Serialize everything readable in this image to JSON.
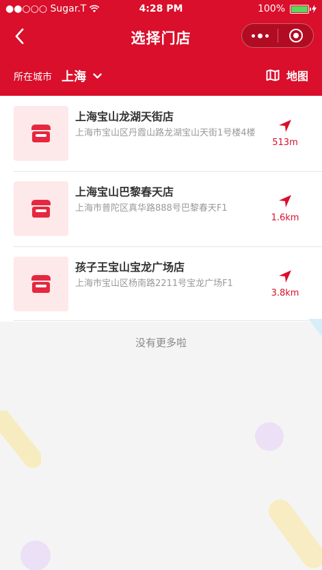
{
  "status_bar": {
    "carrier": "●●○○○ Sugar.T",
    "time": "4:28 PM",
    "battery": "100%"
  },
  "nav": {
    "title": "选择门店",
    "back_icon": "chevron-left-icon",
    "more_icon": "more-dots-icon",
    "close_icon": "target-circle-icon"
  },
  "city_bar": {
    "label": "所在城市",
    "city": "上海",
    "map_label": "地图"
  },
  "stores": [
    {
      "name": "上海宝山龙湖天街店",
      "address": "上海市宝山区丹霞山路龙湖宝山天街1号楼4楼",
      "distance": "513m"
    },
    {
      "name": "上海宝山巴黎春天店",
      "address": "上海市普陀区真华路888号巴黎春天F1",
      "distance": "1.6km"
    },
    {
      "name": "孩子王宝山宝龙广场店",
      "address": "上海市宝山区杨南路2211号宝龙广场F1",
      "distance": "3.8km"
    }
  ],
  "footer": {
    "no_more": "没有更多啦"
  },
  "colors": {
    "primary": "#d90f2b",
    "thumb_bg": "#fde8ea",
    "text_dark": "#333333",
    "text_gray": "#999999",
    "page_bg": "#f4f4f4"
  }
}
